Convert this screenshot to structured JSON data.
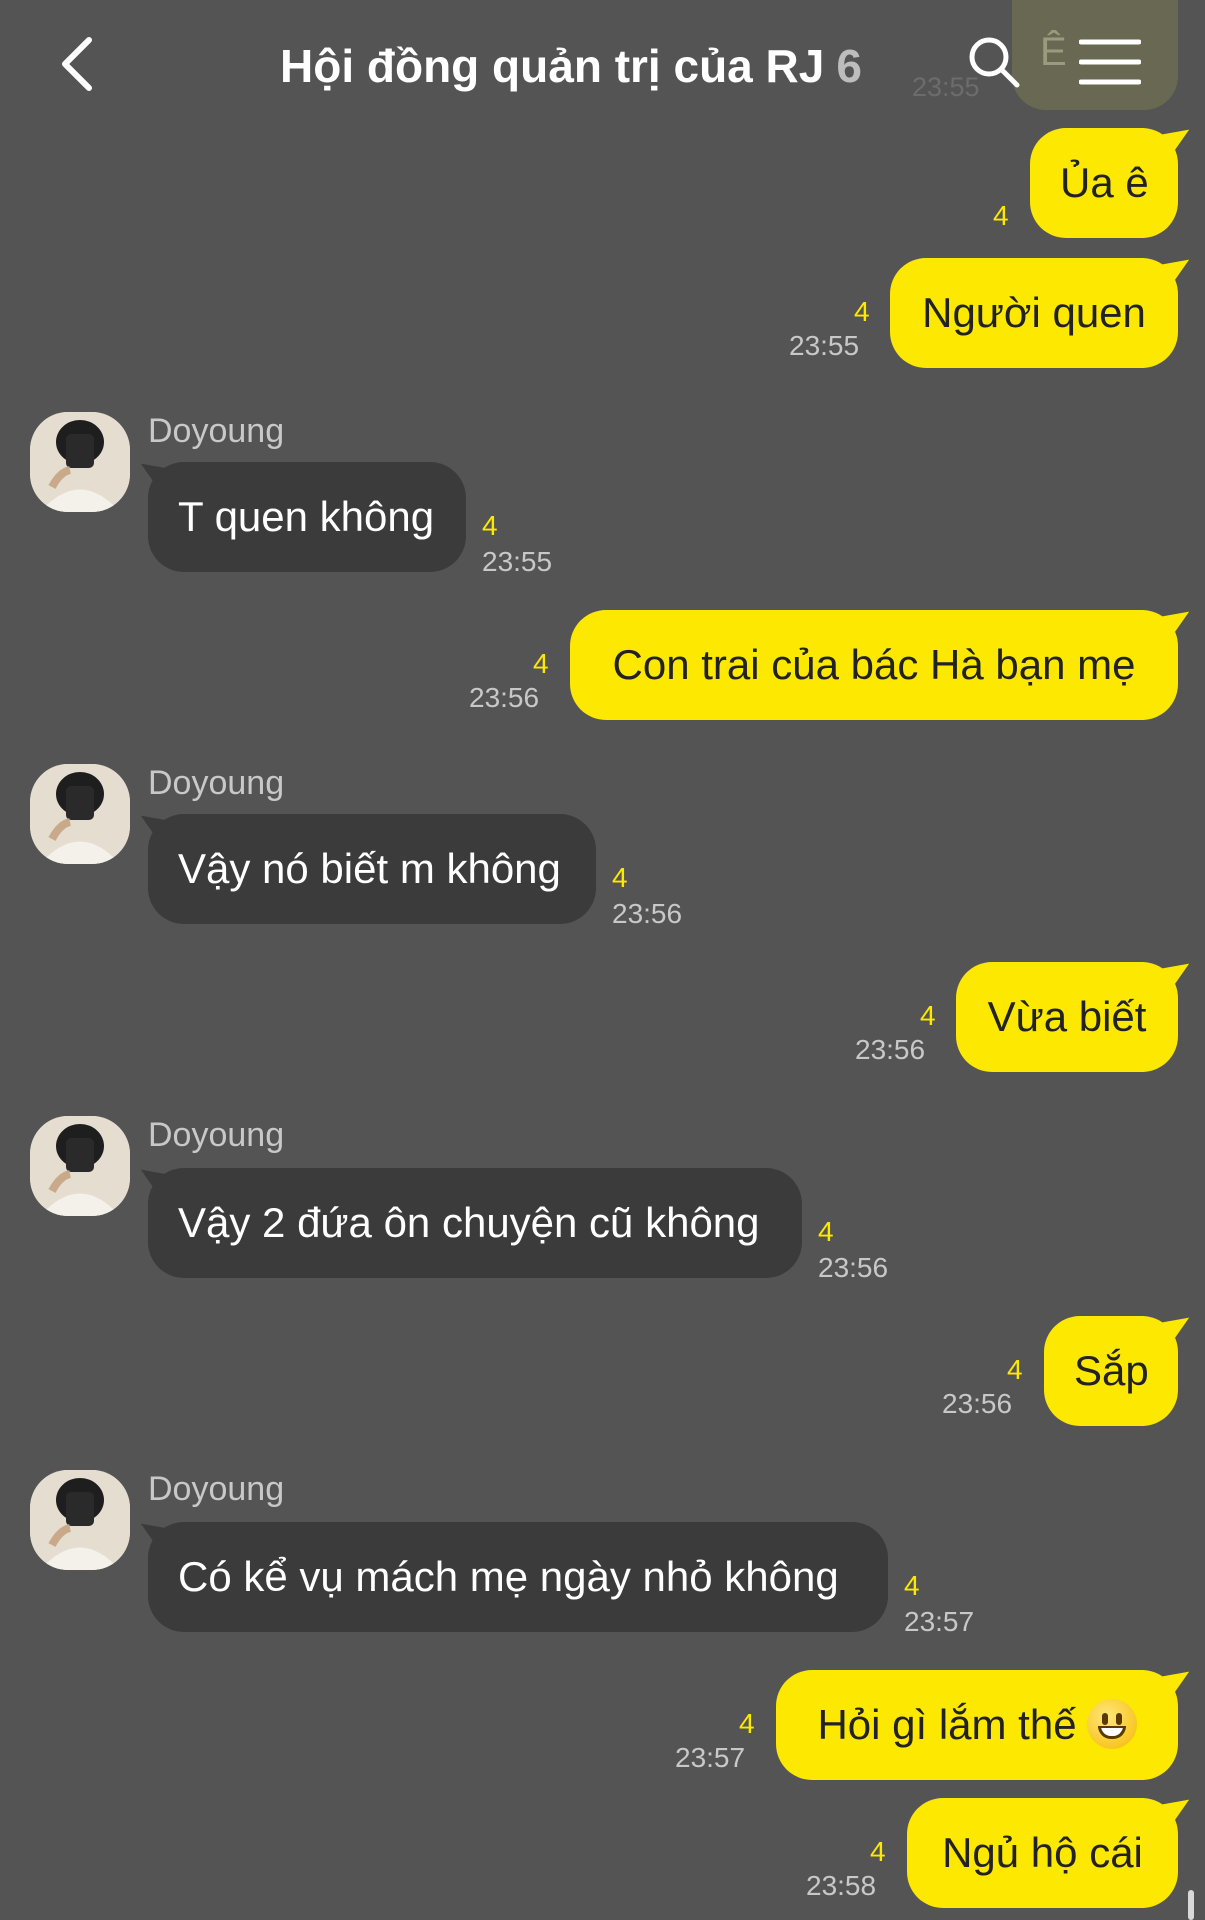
{
  "header": {
    "title": "Hội đồng quản trị của RJ",
    "member_count": "6",
    "back_icon": "chevron-left-icon",
    "search_icon": "search-icon",
    "menu_icon": "menu-icon"
  },
  "ghost_preview": {
    "text": "Ê",
    "time": "23:55"
  },
  "colors": {
    "background": "#545454",
    "my_bubble": "#fce800",
    "their_bubble": "#3b3b3b",
    "unread": "#fce800"
  },
  "messages": [
    {
      "from": "me",
      "text": "Ủa ê",
      "unread": "4",
      "time": ""
    },
    {
      "from": "me",
      "text": "Người quen",
      "unread": "4",
      "time": "23:55"
    },
    {
      "from": "them",
      "sender": "Doyoung",
      "text": "T quen không",
      "unread": "4",
      "time": "23:55"
    },
    {
      "from": "me",
      "text": "Con trai của bác Hà bạn mẹ",
      "unread": "4",
      "time": "23:56"
    },
    {
      "from": "them",
      "sender": "Doyoung",
      "text": "Vậy nó biết m không",
      "unread": "4",
      "time": "23:56"
    },
    {
      "from": "me",
      "text": "Vừa biết",
      "unread": "4",
      "time": "23:56"
    },
    {
      "from": "them",
      "sender": "Doyoung",
      "text": "Vậy 2 đứa ôn chuyện cũ không",
      "unread": "4",
      "time": "23:56"
    },
    {
      "from": "me",
      "text": "Sắp",
      "unread": "4",
      "time": "23:56"
    },
    {
      "from": "them",
      "sender": "Doyoung",
      "text": "Có kể vụ mách mẹ ngày nhỏ không",
      "unread": "4",
      "time": "23:57"
    },
    {
      "from": "me",
      "text": "Hỏi gì lắm thế",
      "emoji": "grinning-face-emoji",
      "unread": "4",
      "time": "23:57"
    },
    {
      "from": "me",
      "text": "Ngủ hộ cái",
      "unread": "4",
      "time": "23:58"
    }
  ]
}
